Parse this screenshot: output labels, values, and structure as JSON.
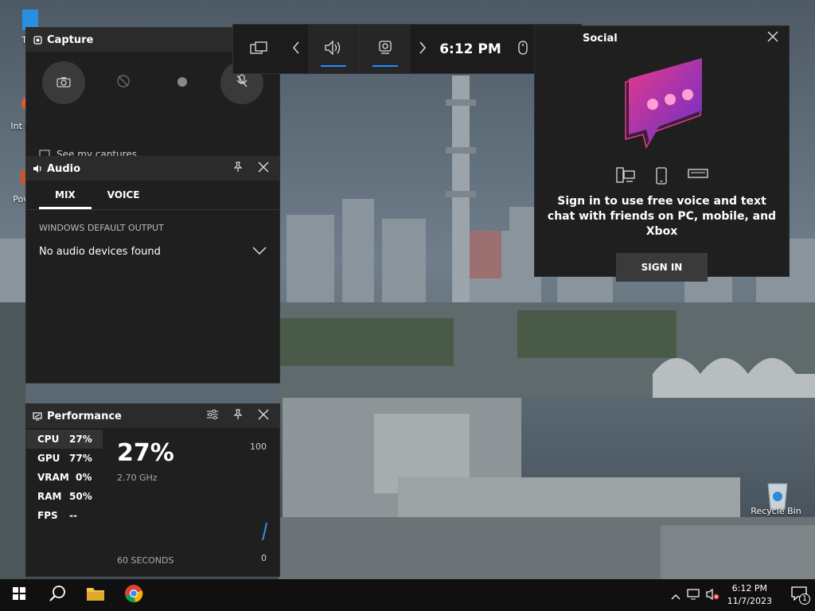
{
  "desktop": {
    "icons": [
      {
        "label": "Th"
      },
      {
        "label": "Int Do"
      },
      {
        "label": "Pov"
      },
      {
        "label": "Recycle Bin"
      }
    ]
  },
  "gamebar": {
    "time": "6:12 PM",
    "accent": "#1e90ff"
  },
  "capture": {
    "title": "Capture",
    "see_captures": "See my captures"
  },
  "audio": {
    "title": "Audio",
    "tabs": [
      {
        "label": "MIX"
      },
      {
        "label": "VOICE"
      }
    ],
    "output_label": "WINDOWS DEFAULT OUTPUT",
    "output_value": "No audio devices found"
  },
  "performance": {
    "title": "Performance",
    "metrics": [
      {
        "name": "CPU",
        "value": "27%"
      },
      {
        "name": "GPU",
        "value": "77%"
      },
      {
        "name": "VRAM",
        "value": "0%"
      },
      {
        "name": "RAM",
        "value": "50%"
      },
      {
        "name": "FPS",
        "value": "--"
      }
    ],
    "big_value": "27%",
    "sub_value": "2.70 GHz",
    "max": "100",
    "min": "0",
    "window": "60 SECONDS"
  },
  "social": {
    "title": "Social",
    "message": "Sign in to use free voice and text chat with friends on PC, mobile, and Xbox",
    "signin_label": "SIGN IN"
  },
  "taskbar": {
    "time": "6:12 PM",
    "date": "11/7/2023",
    "notification_count": "1"
  }
}
